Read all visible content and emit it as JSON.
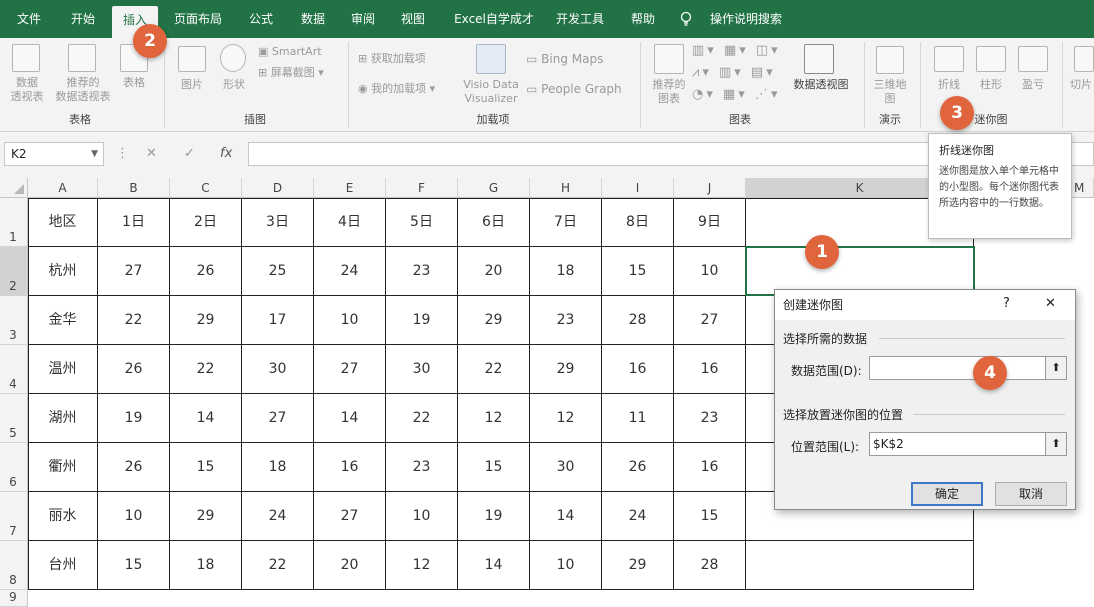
{
  "tabs": [
    "文件",
    "开始",
    "插入",
    "页面布局",
    "公式",
    "数据",
    "审阅",
    "视图",
    "Excel自学成才",
    "开发工具",
    "帮助",
    "操作说明搜索"
  ],
  "ribbon": {
    "table_group": {
      "pivot": [
        "数据",
        "透视表"
      ],
      "recommended_pivot": [
        "推荐的",
        "数据透视表"
      ],
      "table": "表格",
      "label": "表格"
    },
    "illustrations": {
      "picture": "图片",
      "shapes": "形状",
      "smartart": "SmartArt",
      "screenshot": "屏幕截图",
      "label": "插图"
    },
    "addins": {
      "get": "获取加载项",
      "my": "我的加载项",
      "visio": [
        "Visio Data",
        "Visualizer"
      ],
      "bing": "Bing Maps",
      "people": "People Graph",
      "label": "加载项"
    },
    "charts": {
      "recommended": [
        "推荐的",
        "图表"
      ],
      "pivot_chart": "数据透视图",
      "label": "图表"
    },
    "tours": {
      "map3d": [
        "三维地",
        "图"
      ],
      "label": "演示"
    },
    "sparklines": {
      "line": "折线",
      "column": "柱形",
      "winloss": "盈亏",
      "label": "迷你图"
    },
    "slicer": "切片"
  },
  "formula_bar": {
    "name_box": "K2",
    "fx": "fx",
    "value": ""
  },
  "grid": {
    "col_headers": [
      "A",
      "B",
      "C",
      "D",
      "E",
      "F",
      "G",
      "H",
      "I",
      "J",
      "K",
      "M"
    ],
    "row_headers": [
      "1",
      "2",
      "3",
      "4",
      "5",
      "6",
      "7",
      "8",
      "9"
    ],
    "header_row": [
      "地区",
      "1日",
      "2日",
      "3日",
      "4日",
      "5日",
      "6日",
      "7日",
      "8日",
      "9日"
    ],
    "rows": [
      {
        "region": "杭州",
        "values": [
          "27",
          "26",
          "25",
          "24",
          "23",
          "20",
          "18",
          "15",
          "10"
        ]
      },
      {
        "region": "金华",
        "values": [
          "22",
          "29",
          "17",
          "10",
          "19",
          "29",
          "23",
          "28",
          "27"
        ]
      },
      {
        "region": "温州",
        "values": [
          "26",
          "22",
          "30",
          "27",
          "30",
          "22",
          "29",
          "16",
          "16"
        ]
      },
      {
        "region": "湖州",
        "values": [
          "19",
          "14",
          "27",
          "14",
          "22",
          "12",
          "12",
          "11",
          "23"
        ]
      },
      {
        "region": "衢州",
        "values": [
          "26",
          "15",
          "18",
          "16",
          "23",
          "15",
          "30",
          "26",
          "16"
        ]
      },
      {
        "region": "丽水",
        "values": [
          "10",
          "29",
          "24",
          "27",
          "10",
          "19",
          "14",
          "24",
          "15"
        ]
      },
      {
        "region": "台州",
        "values": [
          "15",
          "18",
          "22",
          "20",
          "12",
          "14",
          "10",
          "29",
          "28"
        ]
      }
    ]
  },
  "tooltip": {
    "title": "折线迷你图",
    "body": "迷你图是放入单个单元格中的小型图。每个迷你图代表所选内容中的一行数据。"
  },
  "dialog": {
    "title": "创建迷你图",
    "help": "?",
    "close": "✕",
    "section1": "选择所需的数据",
    "data_range_label": "数据范围(D):",
    "data_range_value": "",
    "section2": "选择放置迷你图的位置",
    "location_label": "位置范围(L):",
    "location_value": "$K$2",
    "ok": "确定",
    "cancel": "取消"
  },
  "badges": [
    "1",
    "2",
    "3",
    "4"
  ],
  "colors": {
    "accent": "#217346",
    "badge": "#e0643c"
  }
}
